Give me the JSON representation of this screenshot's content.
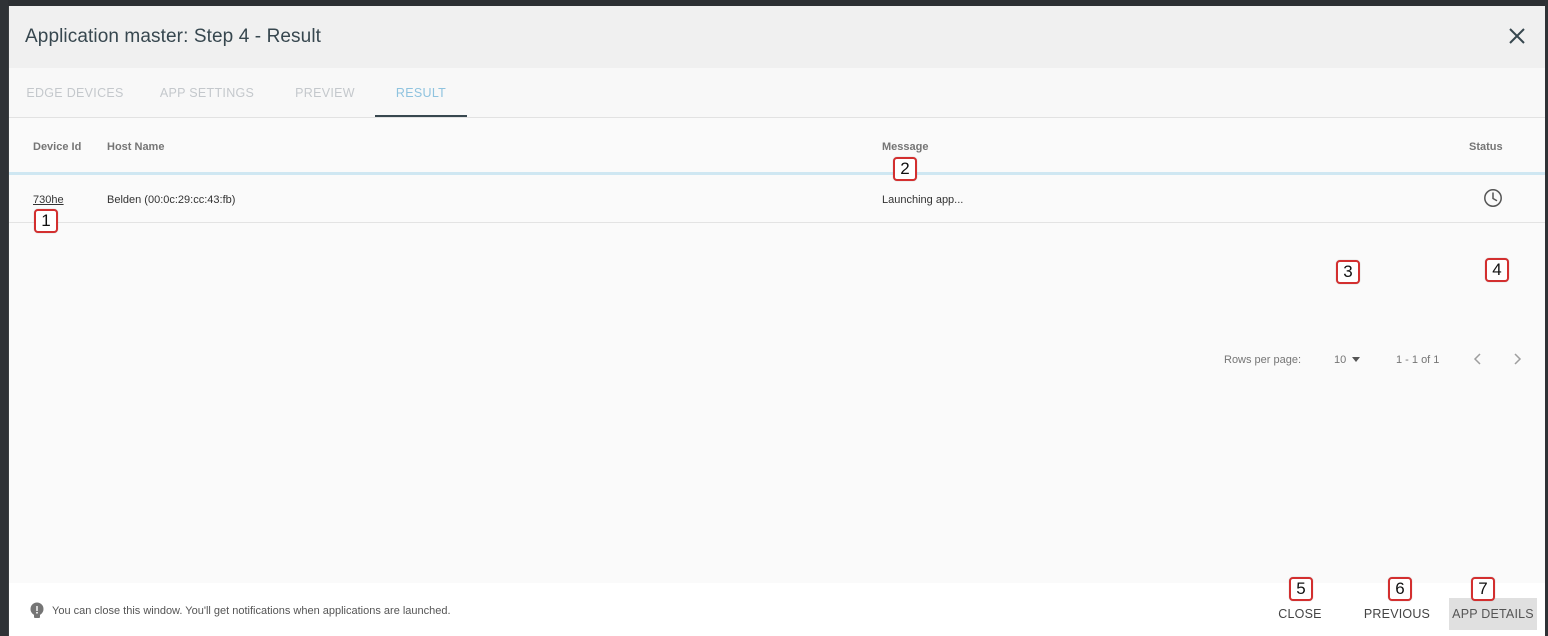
{
  "dialog": {
    "title": "Application master: Step 4 - Result"
  },
  "tabs": [
    {
      "label": "EDGE DEVICES",
      "active": false
    },
    {
      "label": "APP SETTINGS",
      "active": false
    },
    {
      "label": "PREVIEW",
      "active": false
    },
    {
      "label": "RESULT",
      "active": true
    }
  ],
  "table": {
    "headers": {
      "device_id": "Device Id",
      "host_name": "Host Name",
      "message": "Message",
      "status": "Status"
    },
    "rows": [
      {
        "device_id": "730he",
        "host_name": "Belden (00:0c:29:cc:43:fb)",
        "message": "Launching app...",
        "status_icon": "clock-icon"
      }
    ]
  },
  "pagination": {
    "rows_per_page_label": "Rows per page:",
    "rows_per_page_value": "10",
    "range": "1 - 1 of 1"
  },
  "footer": {
    "hint": "You can close this window. You'll get notifications when applications are launched.",
    "hint_icon": "lightbulb-icon",
    "close_label": "CLOSE",
    "previous_label": "PREVIOUS",
    "app_details_label": "APP DETAILS"
  },
  "markers": [
    "1",
    "2",
    "3",
    "4",
    "5",
    "6",
    "7"
  ],
  "colors": {
    "accent_tab": "#8fc3df",
    "header_divider": "#cfe7f2",
    "marker_border": "#d32f2f"
  }
}
